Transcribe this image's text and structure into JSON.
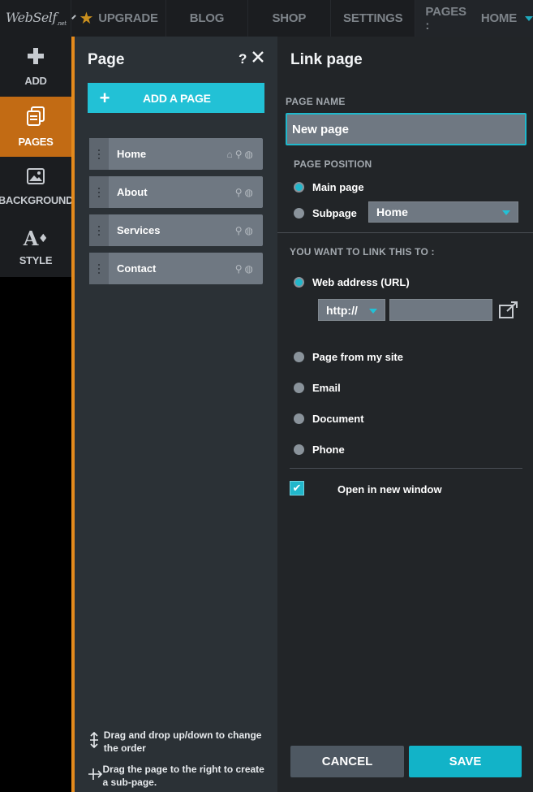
{
  "topbar": {
    "logo_text": "WebSelf",
    "logo_suffix": ".net",
    "upgrade": "UPGRADE",
    "blog": "BLOG",
    "shop": "SHOP",
    "settings": "SETTINGS",
    "pages_label": "PAGES :",
    "current_page": "HOME"
  },
  "rail": {
    "items": [
      {
        "label": "ADD",
        "icon": "plus-icon"
      },
      {
        "label": "PAGES",
        "icon": "pages-icon"
      },
      {
        "label": "BACKGROUND",
        "icon": "image-icon"
      },
      {
        "label": "STYLE",
        "icon": "style-icon"
      }
    ]
  },
  "pages_panel": {
    "title": "Page",
    "help": "?",
    "add_page": "ADD A PAGE",
    "pages": [
      {
        "name": "Home"
      },
      {
        "name": "About"
      },
      {
        "name": "Services"
      },
      {
        "name": "Contact"
      }
    ],
    "hints": [
      "Drag and drop up/down to change the order",
      "Drag the page to the right to create a sub-page."
    ]
  },
  "link_panel": {
    "title": "Link page",
    "page_name_label": "PAGE NAME",
    "page_name_value": "New page",
    "page_position_label": "PAGE POSITION",
    "main_page": "Main page",
    "subpage": "Subpage",
    "subpage_parent": "Home",
    "link_to_label": "YOU WANT TO LINK THIS TO :",
    "web_address": "Web address (URL)",
    "protocol": "http://",
    "page_from_site": "Page from my site",
    "email": "Email",
    "document": "Document",
    "phone": "Phone",
    "open_new_window": "Open in new window",
    "cancel": "CANCEL",
    "save": "SAVE"
  },
  "colors": {
    "accent_orange": "#e48a1c",
    "active_rail": "#c26b14",
    "teal": "#22c1d6"
  }
}
